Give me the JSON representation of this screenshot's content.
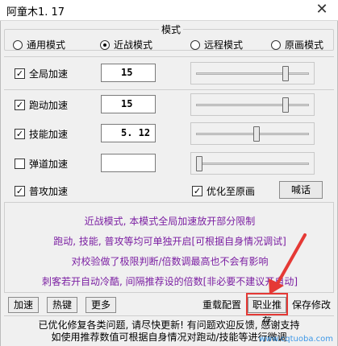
{
  "window": {
    "title": "阿童木1. 17",
    "close_glyph": "✕"
  },
  "mode_group": {
    "label": "模式",
    "options": [
      {
        "label": "通用模式",
        "selected": false
      },
      {
        "label": "近战模式",
        "selected": true
      },
      {
        "label": "远程模式",
        "selected": false
      },
      {
        "label": "原画模式",
        "selected": false
      }
    ]
  },
  "rows": [
    {
      "label": "全局加速",
      "checked": true,
      "value": "15",
      "slider_fraction": 0.8
    },
    {
      "label": "跑动加速",
      "checked": true,
      "value": "15",
      "slider_fraction": 0.8
    },
    {
      "label": "技能加速",
      "checked": true,
      "value": "5. 12",
      "slider_fraction": 0.53
    },
    {
      "label": "弹道加速",
      "checked": false,
      "value": "",
      "slider_fraction": 0.0
    }
  ],
  "normal_attack": {
    "label": "普攻加速",
    "checked": true,
    "optimize_label": "优化至原画",
    "optimize_checked": true,
    "shout_button": "喊话"
  },
  "info_lines": [
    "近战模式, 本模式全局加速放开部分限制",
    "跑动, 技能, 普攻等均可单独开启[可根据自身情况调试]",
    "对校验做了极限判断/倍数调最高也不会有影响",
    "刺客若开自动冷酷, 间隔推荐设的倍数[非必要不建议开自动]"
  ],
  "bottom_buttons": {
    "accelerate": "加速",
    "hotkey": "热键",
    "more": "更多",
    "reset": "重载配置",
    "recommend": "职业推荐",
    "save": "保存修改"
  },
  "status": {
    "line1": "已优化修复各类问题, 请尽快更新! 有问题欢迎反馈, 感谢支持",
    "line2": "如使用推荐数值可根据自身情况对跑动/技能等进行微调"
  },
  "watermark": "www.cqtuoba.com",
  "colors": {
    "info_text": "#7b1fa2",
    "highlight": "#e53935"
  }
}
